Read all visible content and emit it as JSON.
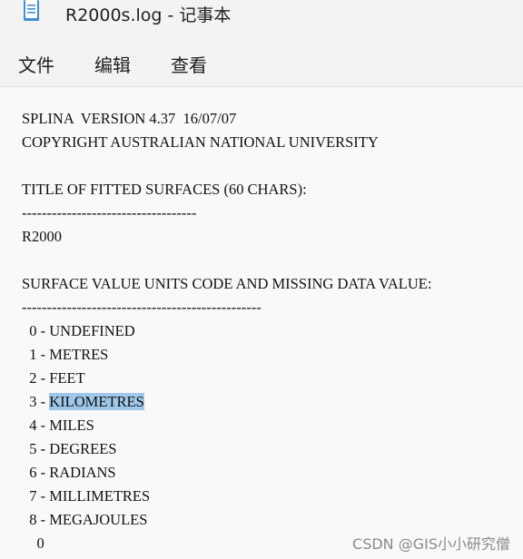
{
  "window": {
    "title": "R2000s.log - 记事本",
    "icon": "notepad-icon"
  },
  "menu": {
    "file": "文件",
    "edit": "编辑",
    "view": "查看"
  },
  "document": {
    "lines": [
      "SPLINA  VERSION 4.37  16/07/07",
      "COPYRIGHT AUSTRALIAN NATIONAL UNIVERSITY",
      "",
      "TITLE OF FITTED SURFACES (60 CHARS):",
      "-----------------------------------",
      "R2000",
      "",
      "SURFACE VALUE UNITS CODE AND MISSING DATA VALUE:",
      "------------------------------------------------",
      "  0 - UNDEFINED",
      "  1 - METRES",
      "  2 - FEET",
      "  3 - ",
      "  4 - MILES",
      "  5 - DEGREES",
      "  6 - RADIANS",
      "  7 - MILLIMETRES",
      "  8 - MEGAJOULES",
      "    0"
    ],
    "selected_text": "KILOMETRES",
    "selection_line_index": 12,
    "selection_color": "#9ec7ea"
  },
  "watermark": "CSDN @GIS小小研究僧"
}
